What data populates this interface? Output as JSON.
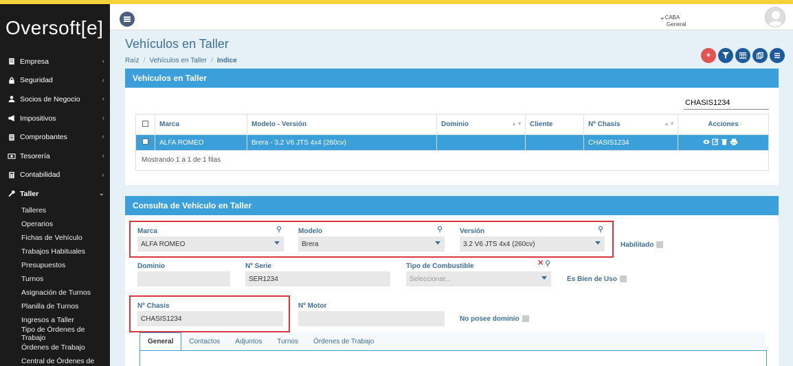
{
  "app": {
    "logo": "Oversoft[e]"
  },
  "sidebar": {
    "items": [
      {
        "label": "Empresa"
      },
      {
        "label": "Seguridad"
      },
      {
        "label": "Socios de Negocio"
      },
      {
        "label": "Impositivos"
      },
      {
        "label": "Comprobantes"
      },
      {
        "label": "Tesorería"
      },
      {
        "label": "Contabilidad"
      },
      {
        "label": "Taller"
      }
    ],
    "subitems": [
      {
        "label": "Talleres"
      },
      {
        "label": "Operarios"
      },
      {
        "label": "Fichas de Vehículo"
      },
      {
        "label": "Trabajos Habituales"
      },
      {
        "label": "Presupuestos"
      },
      {
        "label": "Turnos"
      },
      {
        "label": "Asignación de Turnos"
      },
      {
        "label": "Planilla de Turnos"
      },
      {
        "label": "Ingresos a Taller"
      },
      {
        "label": "Tipo de Órdenes de Trabajo"
      },
      {
        "label": "Órdenes de Trabajo"
      },
      {
        "label": "Central de Órdenes de"
      }
    ]
  },
  "header": {
    "location_city": "CABA",
    "location_sub": "General"
  },
  "page": {
    "title": "Vehículos en Taller",
    "breadcrumb": [
      "Raíz",
      "Vehículos en Taller",
      "Indice"
    ]
  },
  "list_panel": {
    "title": "Vehículos en Taller",
    "search_value": "CHASIS1234",
    "columns": [
      "Marca",
      "Modelo - Versión",
      "Dominio",
      "Cliente",
      "Nº Chasis",
      "Acciones"
    ],
    "rows": [
      {
        "marca": "ALFA ROMEO",
        "modelo": "Brera - 3.2 V6 JTS 4x4 (260cv)",
        "dominio": "",
        "cliente": "",
        "chasis": "CHASIS1234"
      }
    ],
    "footer": "Mostrando 1 a 1 de 1 filas"
  },
  "form_panel": {
    "title": "Consulta de Vehículo en Taller",
    "marca_label": "Marca",
    "marca_value": "ALFA ROMEO",
    "modelo_label": "Modelo",
    "modelo_value": "Brera",
    "version_label": "Versión",
    "version_value": "3.2 V6 JTS 4x4 (260cv)",
    "habilitado_label": "Habilitado",
    "dominio_label": "Dominio",
    "dominio_value": "",
    "serie_label": "Nº Serie",
    "serie_value": "SER1234",
    "combustible_label": "Tipo de Combustible",
    "combustible_placeholder": "Seleccionar...",
    "bien_uso_label": "Es Bien de Uso",
    "chasis_label": "Nº Chasis",
    "chasis_value": "CHASIS1234",
    "motor_label": "Nº Motor",
    "motor_value": "",
    "no_dominio_label": "No posee dominio",
    "tabs": [
      "General",
      "Contactos",
      "Adjuntos",
      "Turnos",
      "Órdenes de Trabajo"
    ]
  },
  "colors": {
    "accent": "#3b9fd9",
    "primary": "#1e5b9c",
    "danger": "#e25454",
    "highlight_box": "#d9363e"
  }
}
